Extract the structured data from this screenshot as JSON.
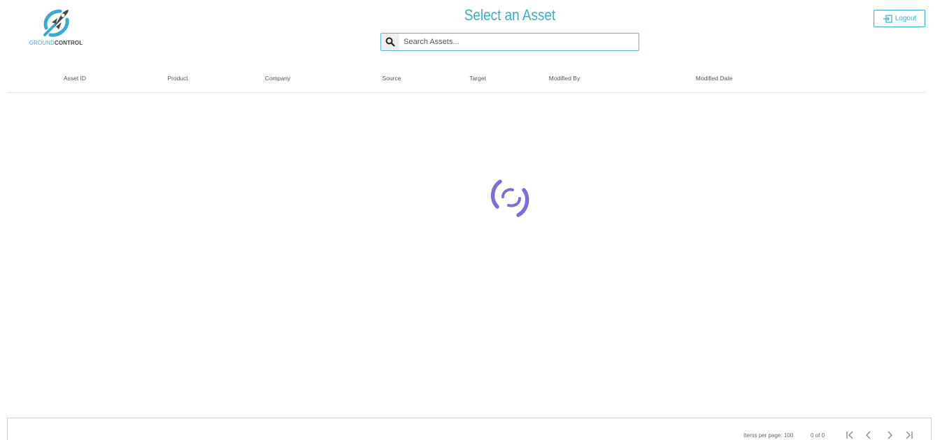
{
  "header": {
    "logo": {
      "text_part1": "GROUND",
      "text_part2": "CONTROL",
      "icon": "rocket-logo-icon",
      "colors": {
        "accent": "#3aaad0",
        "dark": "#444444"
      }
    },
    "title": "Select an Asset",
    "search": {
      "icon": "search-icon",
      "placeholder": "Search Assets...",
      "value": ""
    },
    "logout": {
      "icon": "logout-icon",
      "label": "Logout"
    }
  },
  "table": {
    "columns": [
      "Asset ID",
      "Product",
      "Company",
      "Source",
      "Target",
      "Modified By",
      "Modified Date"
    ],
    "rows": []
  },
  "loading": {
    "icon": "loading-spinner-icon",
    "color": "#7a6fd6"
  },
  "paginator": {
    "items_per_page_label": "Items per page:",
    "items_per_page_value": "100",
    "range_label": "0 of 0",
    "buttons": [
      "first-page-icon",
      "previous-page-icon",
      "next-page-icon",
      "last-page-icon"
    ]
  },
  "theme": {
    "accent": "#3aaec9",
    "border": "#5ab3c8"
  }
}
